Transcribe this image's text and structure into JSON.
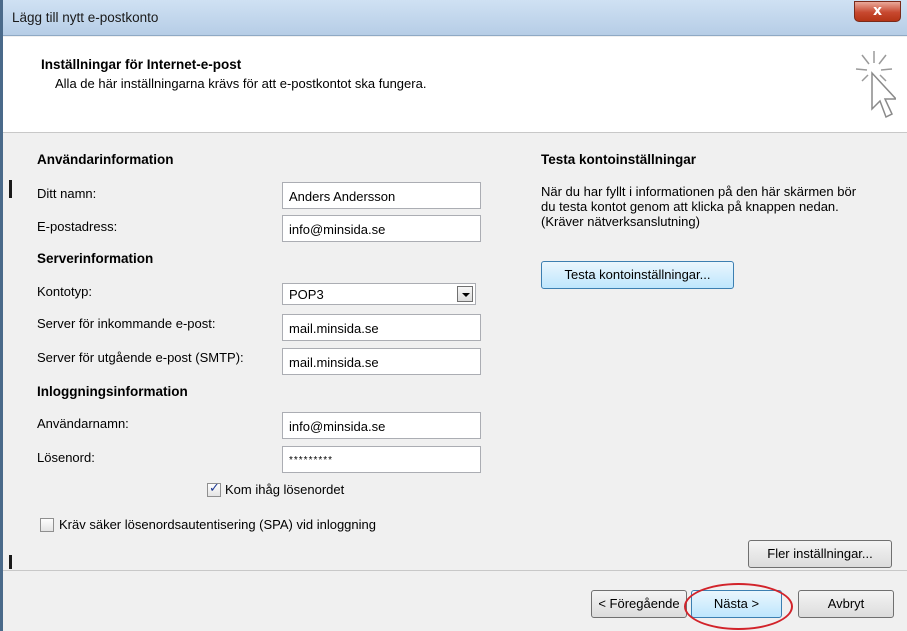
{
  "window": {
    "title": "Lägg till nytt e-postkonto",
    "close_label": "x"
  },
  "header": {
    "title": "Inställningar för Internet-e-post",
    "subtitle": "Alla de här inställningarna krävs för att e-postkontot ska fungera."
  },
  "user_info": {
    "heading": "Användarinformation",
    "name_label": "Ditt namn:",
    "name_value": "Anders Andersson",
    "email_label": "E-postadress:",
    "email_value": "info@minsida.se"
  },
  "server_info": {
    "heading": "Serverinformation",
    "account_type_label": "Kontotyp:",
    "account_type_value": "POP3",
    "incoming_label": "Server för inkommande e-post:",
    "incoming_value": "mail.minsida.se",
    "outgoing_label": "Server för utgående e-post (SMTP):",
    "outgoing_value": "mail.minsida.se"
  },
  "login_info": {
    "heading": "Inloggningsinformation",
    "username_label": "Användarnamn:",
    "username_value": "info@minsida.se",
    "password_label": "Lösenord:",
    "password_value": "*********",
    "remember_label": "Kom ihåg lösenordet",
    "remember_checked": true,
    "spa_label": "Kräv säker lösenordsautentisering (SPA) vid inloggning",
    "spa_checked": false
  },
  "test": {
    "heading": "Testa kontoinställningar",
    "description_line1": "När du har fyllt i informationen på den här skärmen bör",
    "description_line2": "du testa kontot genom att klicka på knappen nedan.",
    "description_line3": "(Kräver nätverksanslutning)",
    "button_label": "Testa kontoinställningar..."
  },
  "buttons": {
    "more_settings": "Fler inställningar...",
    "back": "< Föregående",
    "next": "Nästa >",
    "cancel": "Avbryt"
  },
  "colors": {
    "highlight_oval": "#d2232a",
    "focus_button": "#bee6fd"
  }
}
